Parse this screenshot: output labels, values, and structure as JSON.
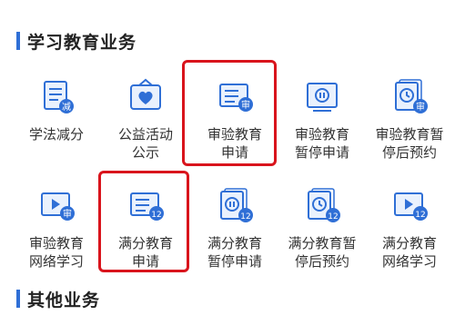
{
  "sections": {
    "study": {
      "title": "学习教育业务"
    },
    "other": {
      "title": "其他业务"
    }
  },
  "tiles": [
    {
      "id": "xuefa-jianfen",
      "label": "学法减分",
      "icon": "document-reduce-icon",
      "badge": "减"
    },
    {
      "id": "gongyi-gongshi",
      "label": "公益活动\n公示",
      "icon": "heart-board-icon",
      "badge": ""
    },
    {
      "id": "shenyan-shenqing",
      "label": "审验教育\n申请",
      "icon": "document-audit-icon",
      "badge": "审"
    },
    {
      "id": "shenyan-zanting",
      "label": "审验教育\n暂停申请",
      "icon": "pause-document-icon",
      "badge": ""
    },
    {
      "id": "shenyan-yuyue",
      "label": "审验教育暂\n停后预约",
      "icon": "clock-document-icon",
      "badge": "审"
    },
    {
      "id": "shenyan-wangluo",
      "label": "审验教育\n网络学习",
      "icon": "video-document-icon",
      "badge": "审"
    },
    {
      "id": "manfen-shenqing",
      "label": "满分教育\n申请",
      "icon": "document-12-icon",
      "badge": "12"
    },
    {
      "id": "manfen-zanting",
      "label": "满分教育\n暂停申请",
      "icon": "pause-document-12-icon",
      "badge": "12"
    },
    {
      "id": "manfen-yuyue",
      "label": "满分教育暂\n停后预约",
      "icon": "clock-document-12-icon",
      "badge": "12"
    },
    {
      "id": "manfen-wangluo",
      "label": "满分教育\n网络学习",
      "icon": "video-document-12-icon",
      "badge": "12"
    }
  ],
  "colors": {
    "accent": "#2f6fd6",
    "icon_fill": "#e9f1fd",
    "highlight": "#d9141c",
    "text": "#333333"
  }
}
